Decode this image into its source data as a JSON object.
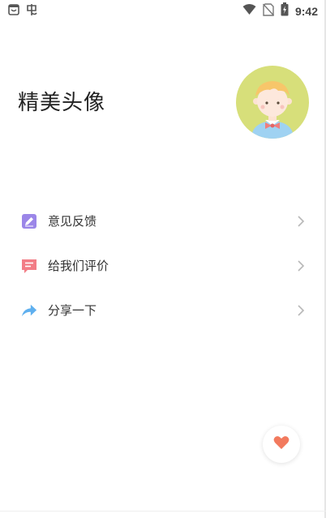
{
  "status_bar": {
    "time": "9:42",
    "icons": [
      "app-notification-icon",
      "bug-app-icon",
      "wifi-icon",
      "no-sim-icon",
      "battery-charging-icon"
    ]
  },
  "header": {
    "title": "精美头像",
    "avatar_icon": "cartoon-boy-avatar"
  },
  "menu": {
    "items": [
      {
        "label": "意见反馈",
        "icon": "edit-pencil-icon",
        "color": "#9b86e8"
      },
      {
        "label": "给我们评价",
        "icon": "comment-bubble-icon",
        "color": "#f27d86"
      },
      {
        "label": "分享一下",
        "icon": "share-arrow-icon",
        "color": "#5fb0ef"
      }
    ]
  },
  "fab": {
    "icon": "heart-icon",
    "color": "#f27a5e"
  },
  "colors": {
    "avatar_bg": "#d7df7a",
    "chevron": "#b8b8b8"
  }
}
